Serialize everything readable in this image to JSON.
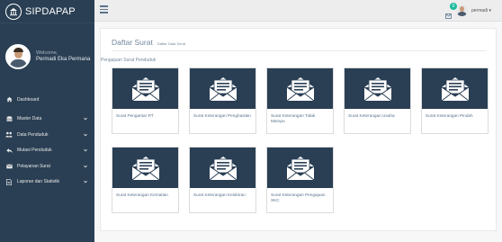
{
  "brand": {
    "name": "SIPDAPAP"
  },
  "profile": {
    "welcome": "Welcome,",
    "name": "Permadi Eka Permana"
  },
  "menu": [
    {
      "label": "Dashboard",
      "icon": "home-icon",
      "has_submenu": false
    },
    {
      "label": "Master Data",
      "icon": "database-icon",
      "has_submenu": true
    },
    {
      "label": "Data Penduduk",
      "icon": "users-icon",
      "has_submenu": true
    },
    {
      "label": "Mutasi Penduduk",
      "icon": "reply-icon",
      "has_submenu": true
    },
    {
      "label": "Pelayanan Surat",
      "icon": "envelope-icon",
      "has_submenu": true
    },
    {
      "label": "Laporan dan Statistik",
      "icon": "file-icon",
      "has_submenu": true
    }
  ],
  "topbar": {
    "notification_count": "0",
    "user": "permadi"
  },
  "page": {
    "title": "Daftar Surat",
    "subtitle": "Daftar Data Surat",
    "section": "Pengajuan Surat Penduduk"
  },
  "cards": [
    {
      "label": "Surat Pengantar RT"
    },
    {
      "label": "Surat Keterangan Penghasilan"
    },
    {
      "label": "Surat Keterangan Tidak Mampu"
    },
    {
      "label": "Surat Keterangan Usaha"
    },
    {
      "label": "Surat Keterangan Pindah"
    },
    {
      "label": "Surat Keterangan Kematian"
    },
    {
      "label": "Surat Keterangan Kelahiran"
    },
    {
      "label": "Surat Keterangan Pengajuan SKC"
    }
  ],
  "colors": {
    "sidebar": "#2a3f54",
    "accent": "#1abb9c",
    "card_image": "#2a3f54"
  }
}
